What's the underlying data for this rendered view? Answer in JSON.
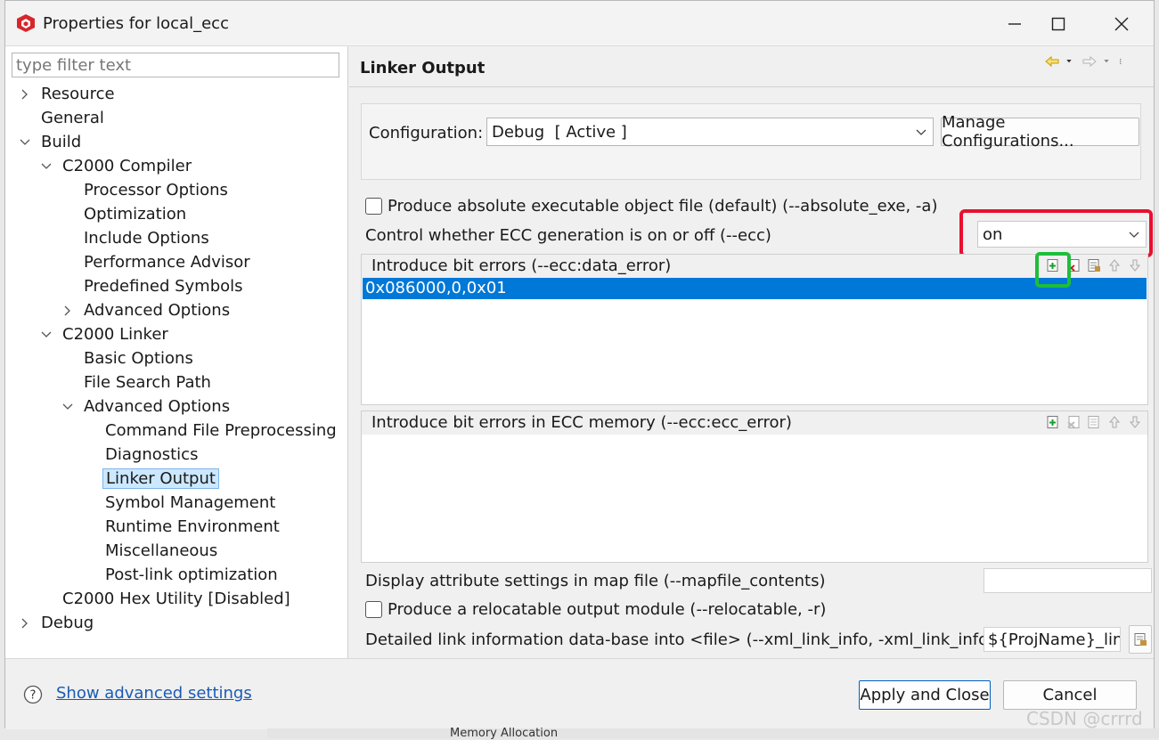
{
  "window": {
    "title": "Properties for local_ecc"
  },
  "filter": {
    "placeholder": "type filter text"
  },
  "tree": [
    {
      "label": "Resource",
      "expander": "collapsed"
    },
    {
      "label": "General",
      "expander": "none"
    },
    {
      "label": "Build",
      "expander": "expanded"
    },
    {
      "label": "C2000 Compiler",
      "expander": "expanded"
    },
    {
      "label": "Processor Options",
      "expander": "none"
    },
    {
      "label": "Optimization",
      "expander": "none"
    },
    {
      "label": "Include Options",
      "expander": "none"
    },
    {
      "label": "Performance Advisor",
      "expander": "none"
    },
    {
      "label": "Predefined Symbols",
      "expander": "none"
    },
    {
      "label": "Advanced Options",
      "expander": "collapsed"
    },
    {
      "label": "C2000 Linker",
      "expander": "expanded"
    },
    {
      "label": "Basic Options",
      "expander": "none"
    },
    {
      "label": "File Search Path",
      "expander": "none"
    },
    {
      "label": "Advanced Options",
      "expander": "expanded"
    },
    {
      "label": "Command File Preprocessing",
      "expander": "none"
    },
    {
      "label": "Diagnostics",
      "expander": "none"
    },
    {
      "label": "Linker Output",
      "expander": "none",
      "selected": true
    },
    {
      "label": "Symbol Management",
      "expander": "none"
    },
    {
      "label": "Runtime Environment",
      "expander": "none"
    },
    {
      "label": "Miscellaneous",
      "expander": "none"
    },
    {
      "label": "Post-link optimization",
      "expander": "none"
    },
    {
      "label": "C2000 Hex Utility  [Disabled]",
      "expander": "none"
    },
    {
      "label": "Debug",
      "expander": "collapsed"
    }
  ],
  "page": {
    "title": "Linker Output",
    "configuration": {
      "label": "Configuration:",
      "value": "Debug  [ Active ]",
      "manage_button": "Manage Configurations..."
    },
    "absolute_exe": {
      "label": "Produce absolute executable object file (default) (--absolute_exe, -a)",
      "checked": false
    },
    "ecc": {
      "label": "Control whether ECC generation is on or off (--ecc)",
      "value": "on"
    },
    "data_error": {
      "header": "Introduce bit errors (--ecc:data_error)",
      "items": [
        "0x086000,0,0x01"
      ]
    },
    "ecc_error": {
      "header": "Introduce bit errors in ECC memory (--ecc:ecc_error)",
      "items": []
    },
    "mapfile_contents": {
      "label": "Display attribute settings in map file (--mapfile_contents)",
      "value": ""
    },
    "relocatable": {
      "label": "Produce a relocatable output module (--relocatable, -r)",
      "checked": false
    },
    "xml_link_info": {
      "label": "Detailed link information data-base into <file> (--xml_link_info, -xml_link_info)",
      "value": "${ProjName}_link"
    }
  },
  "bottom": {
    "advanced_link": "Show advanced settings",
    "apply_close": "Apply and Close",
    "cancel": "Cancel"
  },
  "watermark": "CSDN @crrrd",
  "underlying": {
    "tab_text": "Memory Allocation"
  },
  "colors": {
    "selection": "#0078d7",
    "annotation_red": "#e8102f",
    "annotation_green": "#1fbd3b",
    "link": "#1a5bb4"
  }
}
